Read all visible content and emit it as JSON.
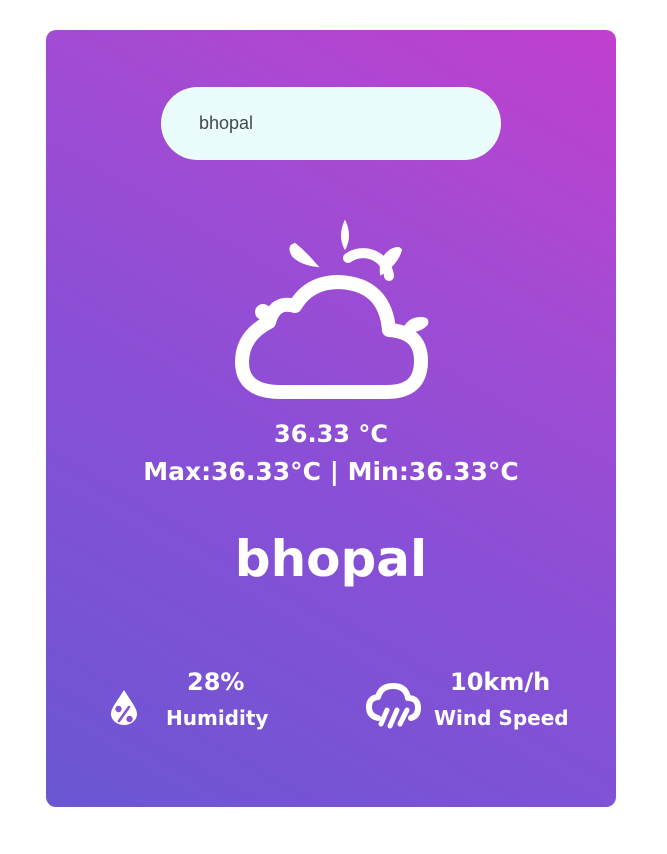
{
  "search": {
    "value": "bhopal"
  },
  "weather": {
    "icon": "cloud-sun-icon",
    "temperature": "36.33 °C",
    "range": "Max:36.33°C | Min:36.33°C",
    "city": "bhopal"
  },
  "stats": {
    "humidity": {
      "icon": "humidity-icon",
      "value": "28%",
      "label": "Humidity"
    },
    "wind": {
      "icon": "wind-rain-icon",
      "value": "10km/h",
      "label": "Wind Speed"
    }
  },
  "colors": {
    "gradient_top": "#c13fcf",
    "gradient_bottom": "#6b57d2",
    "search_background": "#eafcfc",
    "text": "#ffffff"
  }
}
